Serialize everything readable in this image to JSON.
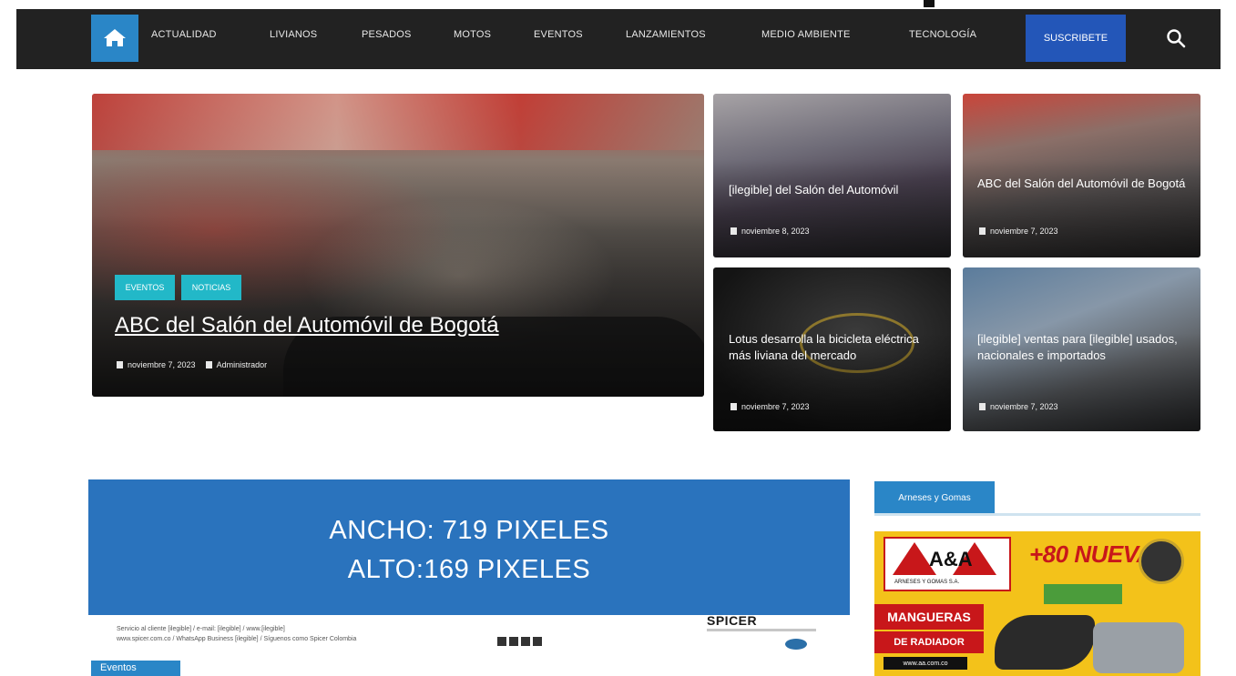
{
  "nav": {
    "items": [
      "ACTUALIDAD",
      "LIVIANOS",
      "PESADOS",
      "MOTOS",
      "EVENTOS",
      "LANZAMIENTOS",
      "MEDIO AMBIENTE",
      "TECNOLOGÍA"
    ],
    "subscribe_label": "SUSCRIBETE",
    "home_icon": "home-icon",
    "search_icon": "search-icon",
    "home_color": "#2a86c7",
    "subscribe_color": "#2356b8"
  },
  "featured": {
    "tags": [
      "EVENTOS",
      "NOTICIAS"
    ],
    "title": "ABC del Salón del Automóvil de Bogotá",
    "date": "noviembre 7, 2023",
    "author": "Administrador"
  },
  "cards": [
    {
      "title": "[ilegible] del Salón del Automóvil",
      "date": "noviembre 8, 2023"
    },
    {
      "title": "ABC del Salón del Automóvil de Bogotá",
      "date": "noviembre 7, 2023"
    },
    {
      "title": "Lotus desarrolla la bicicleta eléctrica más liviana del mercado",
      "date": "noviembre 7, 2023"
    },
    {
      "title": "[ilegible] ventas para [ilegible] usados, nacionales e importados",
      "date": "noviembre 7, 2023"
    }
  ],
  "ad_banner": {
    "line1": "ANCHO: 719 PIXELES",
    "line2": "ALTO:169  PIXELES",
    "color": "#2a73bd"
  },
  "footer_ad": {
    "fine_print_1": "Servicio al cliente [ilegible] / e-mail: [ilegible] / www.[ilegible]",
    "fine_print_2": "www.spicer.com.co / WhatsApp Business [ilegible] / Síguenos como Spicer Colombia",
    "brand": "SPICER"
  },
  "section_tab": "Eventos",
  "sidebar": {
    "heading": "Arneses y Gomas",
    "ad": {
      "brand": "A&A",
      "brand_sub": "ARNESES Y GOMAS S.A.",
      "headline": "+80 NUEVAS",
      "line1": "MANGUERAS",
      "line2": "DE RADIADOR",
      "url": "www.aa.com.co",
      "brand_color": "#c8171a",
      "background": "#f3c21a"
    }
  }
}
